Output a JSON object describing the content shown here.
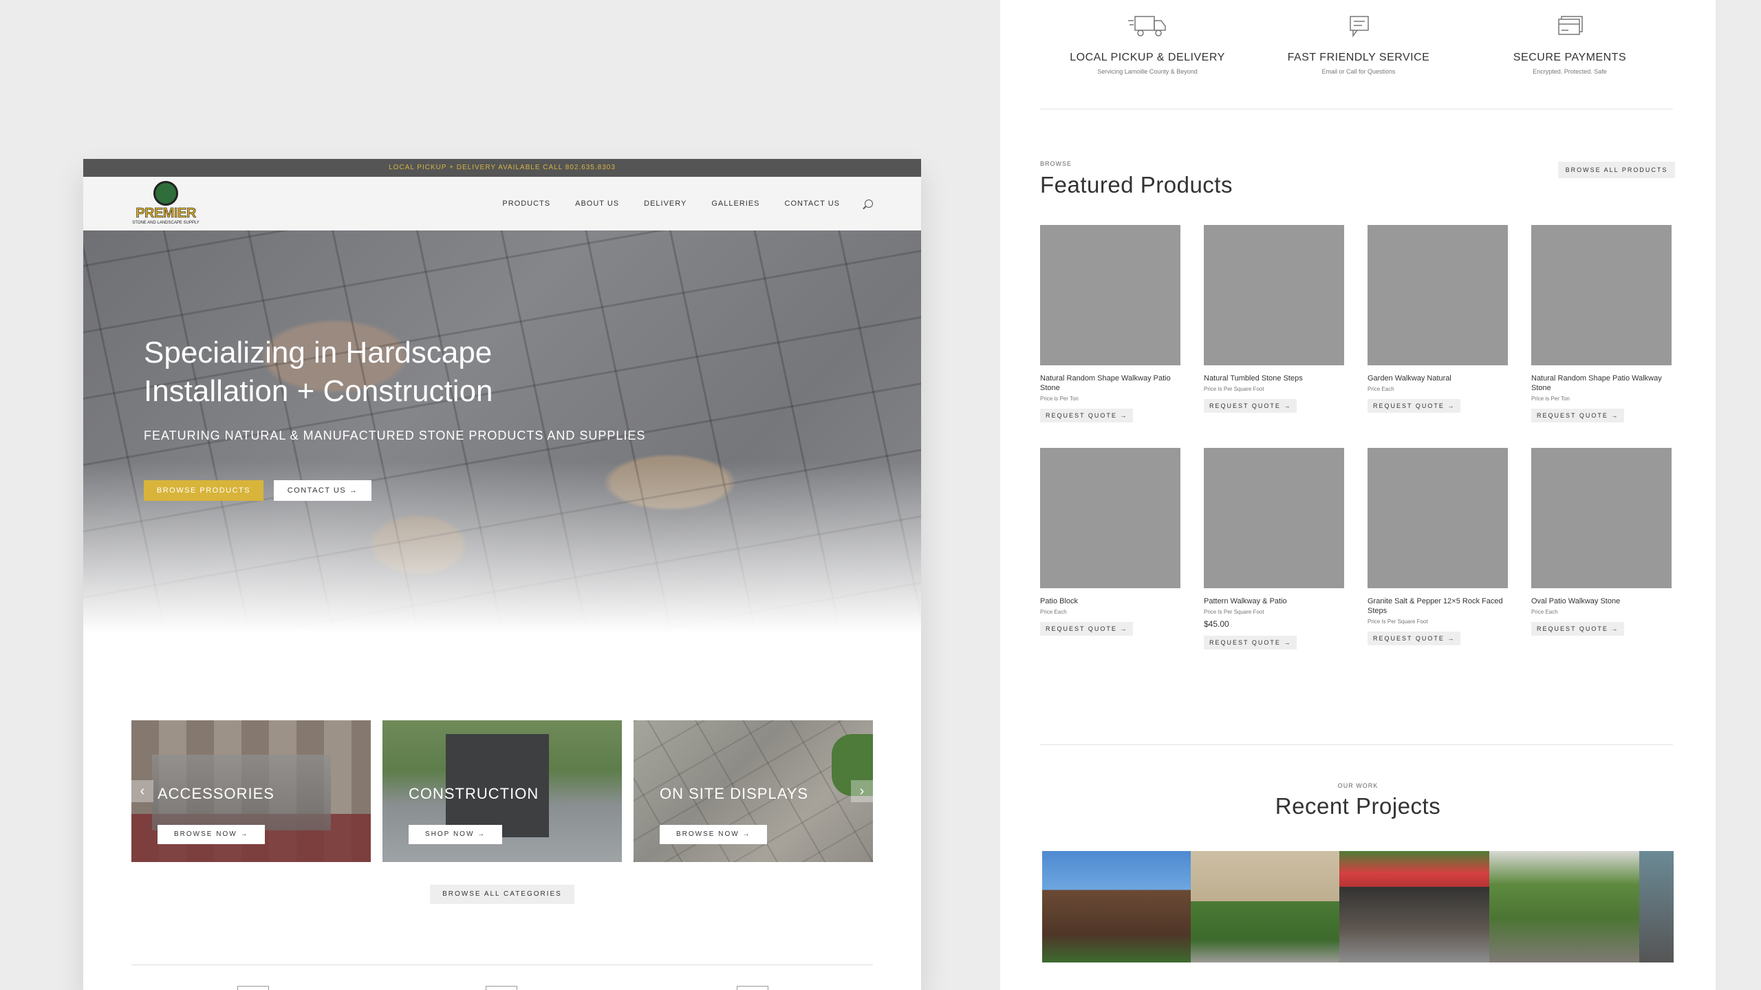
{
  "left": {
    "topbar": "LOCAL PICKUP + DELIVERY AVAILABLE CALL 802.635.8303",
    "logo": {
      "brand": "PREMIER",
      "tagline": "STONE AND LANDSCAPE SUPPLY"
    },
    "nav": [
      "PRODUCTS",
      "ABOUT US",
      "DELIVERY",
      "GALLERIES",
      "CONTACT US"
    ],
    "hero": {
      "title_line1": "Specializing in Hardscape",
      "title_line2": "Installation + Construction",
      "subtitle": "FEATURING NATURAL & MANUFACTURED STONE PRODUCTS AND SUPPLIES",
      "btn_primary": "BROWSE PRODUCTS",
      "btn_secondary": "CONTACT US →"
    },
    "categories": [
      {
        "title": "ACCESSORIES",
        "button": "BROWSE NOW →"
      },
      {
        "title": "CONSTRUCTION",
        "button": "SHOP NOW →"
      },
      {
        "title": "ON SITE DISPLAYS",
        "button": "BROWSE NOW →"
      }
    ],
    "browse_all_categories": "BROWSE ALL CATEGORIES",
    "arrow_prev": "‹",
    "arrow_next": "›"
  },
  "right": {
    "features": [
      {
        "icon": "truck-icon",
        "title": "LOCAL PICKUP & DELIVERY",
        "subtitle": "Servicing Lamoille County & Beyond"
      },
      {
        "icon": "chat-icon",
        "title": "FAST FRIENDLY SERVICE",
        "subtitle": "Email or Call for Questions"
      },
      {
        "icon": "credit-card-icon",
        "title": "SECURE PAYMENTS",
        "subtitle": "Encrypted. Protected. Safe"
      }
    ],
    "featured": {
      "kicker": "BROWSE",
      "title": "Featured Products",
      "browse_all": "BROWSE ALL PRODUCTS",
      "products": [
        {
          "name": "Natural Random Shape Walkway Patio Stone",
          "price_note": "Price is Per Ton",
          "price": "",
          "button": "REQUEST QUOTE →"
        },
        {
          "name": "Natural Tumbled Stone Steps",
          "price_note": "Price Is Per Square Foot",
          "price": "",
          "button": "REQUEST QUOTE →"
        },
        {
          "name": "Garden Walkway Natural",
          "price_note": "Price Each",
          "price": "",
          "button": "REQUEST QUOTE →"
        },
        {
          "name": "Natural Random Shape Patio Walkway Stone",
          "price_note": "Price is Per Ton",
          "price": "",
          "button": "REQUEST QUOTE →"
        },
        {
          "name": "Patio Block",
          "price_note": "Price Each",
          "price": "",
          "button": "REQUEST QUOTE →"
        },
        {
          "name": "Pattern Walkway & Patio",
          "price_note": "Price Is Per Square Foot",
          "price": "$45.00",
          "button": "REQUEST QUOTE →"
        },
        {
          "name": "Granite Salt & Pepper 12×5 Rock Faced Steps",
          "price_note": "Price Is Per Square Foot",
          "price": "",
          "button": "REQUEST QUOTE →"
        },
        {
          "name": "Oval Patio Walkway Stone",
          "price_note": "Price Each",
          "price": "",
          "button": "REQUEST QUOTE →"
        }
      ]
    },
    "projects": {
      "kicker": "OUR WORK",
      "title": "Recent Projects"
    }
  },
  "colors": {
    "accent": "#d8b43a",
    "topbar": "#555555",
    "background": "#ececec"
  }
}
